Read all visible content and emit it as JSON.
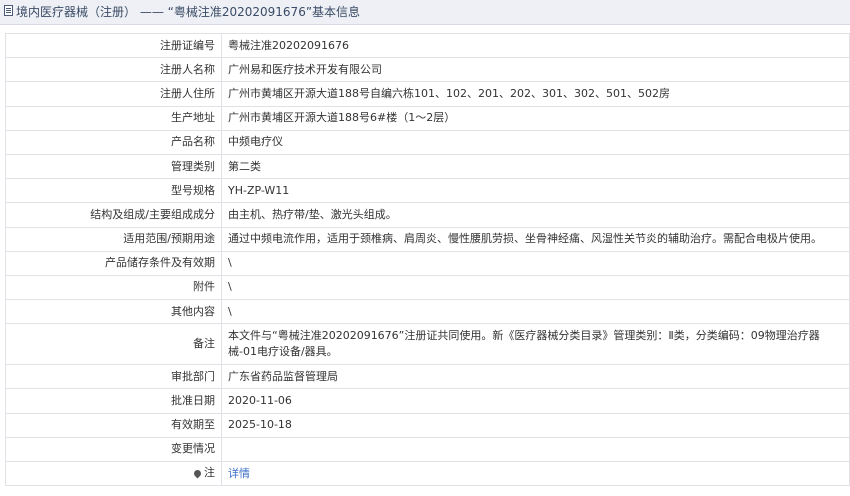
{
  "header": {
    "title": "境内医疗器械（注册） —— “粤械注准20202091676”基本信息"
  },
  "rows": [
    {
      "label": "注册证编号",
      "value": "粤械注准20202091676"
    },
    {
      "label": "注册人名称",
      "value": "广州易和医疗技术开发有限公司"
    },
    {
      "label": "注册人住所",
      "value": "广州市黄埔区开源大道188号自编六栋101、102、201、202、301、302、501、502房"
    },
    {
      "label": "生产地址",
      "value": "广州市黄埔区开源大道188号6#楼（1～2层）"
    },
    {
      "label": "产品名称",
      "value": "中频电疗仪"
    },
    {
      "label": "管理类别",
      "value": "第二类"
    },
    {
      "label": "型号规格",
      "value": "YH-ZP-W11"
    },
    {
      "label": "结构及组成/主要组成成分",
      "value": "由主机、热疗带/垫、激光头组成。"
    },
    {
      "label": "适用范围/预期用途",
      "value": "通过中频电流作用，适用于颈椎病、肩周炎、慢性腰肌劳损、坐骨神经痛、风湿性关节炎的辅助治疗。需配合电极片使用。"
    },
    {
      "label": "产品储存条件及有效期",
      "value": "\\"
    },
    {
      "label": "附件",
      "value": "\\"
    },
    {
      "label": "其他内容",
      "value": "\\"
    },
    {
      "label": "备注",
      "value": "本文件与“粤械注准20202091676”注册证共同使用。新《医疗器械分类目录》管理类别：Ⅱ类，分类编码：09物理治疗器械-01电疗设备/器具。"
    },
    {
      "label": "审批部门",
      "value": "广东省药品监督管理局"
    },
    {
      "label": "批准日期",
      "value": "2020-11-06"
    },
    {
      "label": "有效期至",
      "value": "2025-10-18"
    },
    {
      "label": "变更情况",
      "value": ""
    }
  ],
  "note": {
    "label": "注",
    "icon": "pin-icon",
    "link_text": "详情"
  }
}
